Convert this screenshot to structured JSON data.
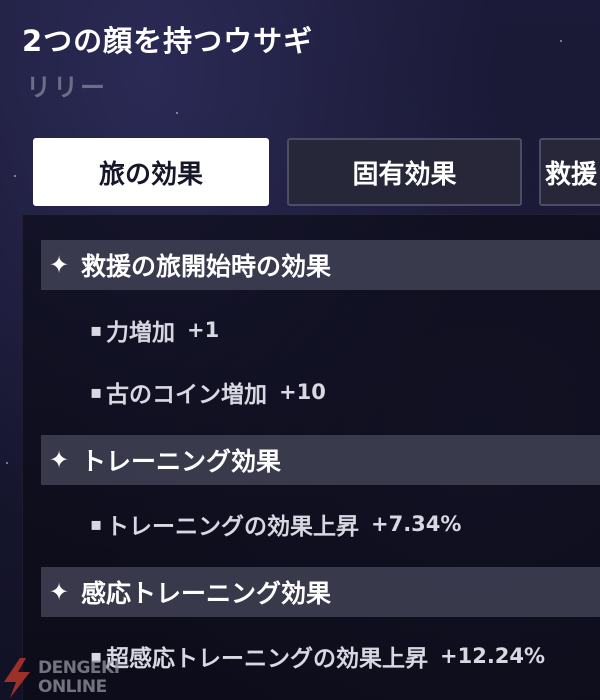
{
  "header": {
    "title": "2つの顔を持つウサギ",
    "name": "リリー"
  },
  "tabs": [
    {
      "label": "旅の効果",
      "active": true
    },
    {
      "label": "固有効果",
      "active": false
    },
    {
      "label": "救援",
      "active": false
    }
  ],
  "sections": [
    {
      "title": "救援の旅開始時の効果",
      "effects": [
        {
          "label": "力増加",
          "value": "+1"
        },
        {
          "label": "古のコイン増加",
          "value": "+10"
        }
      ]
    },
    {
      "title": "トレーニング効果",
      "effects": [
        {
          "label": "トレーニングの効果上昇",
          "value": "+7.34%"
        }
      ]
    },
    {
      "title": "感応トレーニング効果",
      "effects": [
        {
          "label": "超感応トレーニングの効果上昇",
          "value": "+12.24%"
        }
      ]
    }
  ],
  "watermark": {
    "line1": "DENGEKI",
    "line2": "ONLINE"
  },
  "colors": {
    "background": "#141428",
    "active_tab_bg": "#ffffff",
    "active_tab_text": "#17172a",
    "inactive_tab_bg": "#28283a",
    "section_bg": "#48485c",
    "subtitle": "#6c6d88",
    "watermark_red": "#c0392b"
  }
}
